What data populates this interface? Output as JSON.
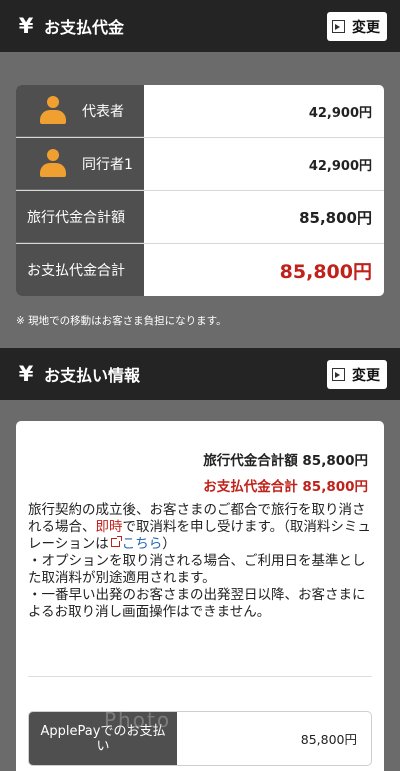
{
  "payment_section": {
    "icon": "yen-icon",
    "title": "お支払代金",
    "change_label": "変更"
  },
  "price_table": {
    "rows": [
      {
        "label": "代表者",
        "icon": "person-icon",
        "value": "42,900円"
      },
      {
        "label": "同行者1",
        "icon": "person-icon",
        "value": "42,900円"
      },
      {
        "label": "旅行代金合計額",
        "value": "85,800円"
      },
      {
        "label": "お支払代金合計",
        "value": "85,800円"
      }
    ],
    "note": "※ 現地での移動はお客さま負担になります。"
  },
  "info_section": {
    "icon": "yen-icon",
    "title": "お支払い情報",
    "change_label": "変更"
  },
  "info_card": {
    "total_line": "旅行代金合計額 85,800円",
    "payment_line": "お支払代金合計 85,800円",
    "para1_before": "旅行契約の成立後、お客さまのご都合で旅行を取り消される場合、",
    "para1_highlight": "即時",
    "para1_middle": "で取消料を申し受けます。（取消料シミュレーションは",
    "para1_link": "こちら",
    "para1_after": "）",
    "bullet1": "・オプションを取り消される場合、ご利用日を基準とした取消料が別途適用されます。",
    "bullet2": "・一番早い出発のお客さまの出発翌日以降、お客さまによるお取り消し画面操作はできません。",
    "payment_method_label": "ApplePayでのお支払い",
    "payment_method_value": "85,800円",
    "watermark": "Photo"
  },
  "colors": {
    "page_bg": "#6b6b6b",
    "header_bg": "#242424",
    "label_bg": "#4f4f4f",
    "accent_red": "#c0221b",
    "person_icon": "#f0a030",
    "link": "#2767b8"
  }
}
